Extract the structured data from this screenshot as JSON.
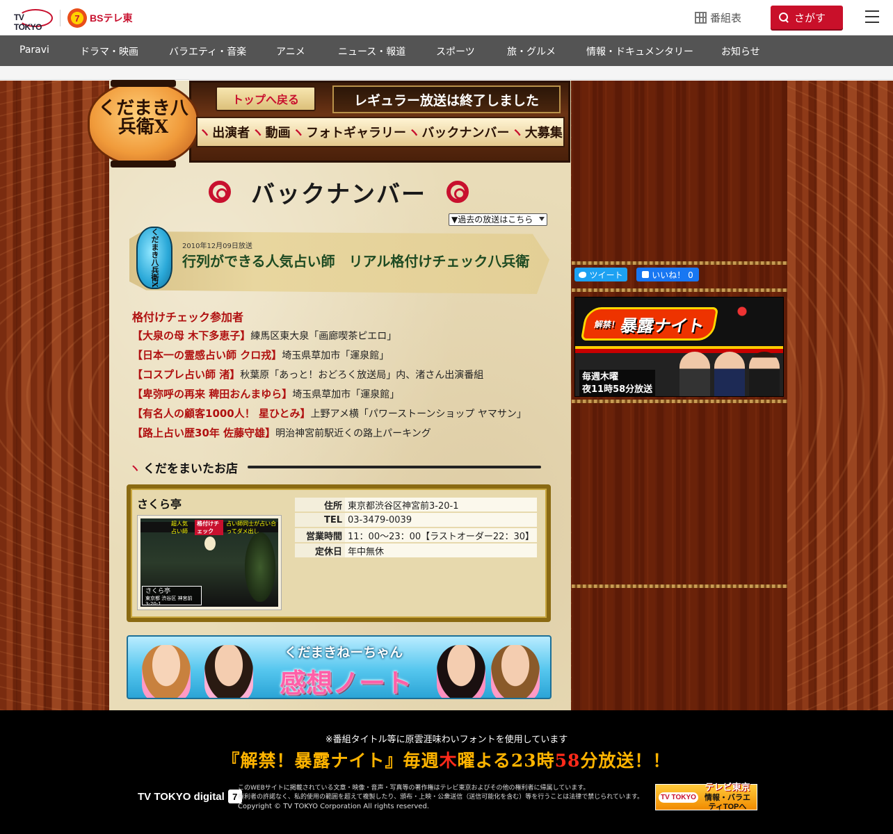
{
  "header": {
    "logo_tvtokyo": "TV TOKYO",
    "logo_bs": "BSテレ東",
    "logo_bs_badge": "7",
    "program_guide": "番組表",
    "search_label": "さがす"
  },
  "nav": {
    "items": [
      "Paravi",
      "ドラマ・映画",
      "バラエティ・音楽",
      "アニメ",
      "ニュース・報道",
      "スポーツ",
      "旅・グルメ",
      "情報・ドキュメンタリー",
      "お知らせ"
    ]
  },
  "banner": {
    "show_title": "くだまき八兵衛X",
    "back_to_top": "トップへ戻る",
    "ended_notice": "レギュラー放送は終了しました",
    "nav_items": [
      "出演者",
      "動画",
      "フォトギャラリー",
      "バックナンバー",
      "大募集"
    ]
  },
  "page": {
    "heading": "バックナンバー",
    "archive_select": "▼過去の放送はこちら"
  },
  "episode": {
    "lantern_text": "くだまき八兵衛X",
    "date": "2010年12月09日放送",
    "title": "行列ができる人気占い師　リアル格付けチェック八兵衛"
  },
  "participants": {
    "heading": "格付けチェック参加者",
    "rows": [
      {
        "name": "【大泉の母 木下多恵子】",
        "place": "練馬区東大泉「画廊喫茶ピエロ」"
      },
      {
        "name": "【日本一の霊感占い師 クロ戎】",
        "place": "埼玉県草加市「運泉館」"
      },
      {
        "name": "【コスプレ占い師 渚】",
        "place": "秋葉原「あっと！おどろく放送局」内、渚さん出演番組"
      },
      {
        "name": "【卑弥呼の再来 稗田おんまゆら】",
        "place": "埼玉県草加市「運泉館」"
      },
      {
        "name": "【有名人の顧客1000人！ 星ひとみ】",
        "place": "上野アメ横「パワーストーンショップ ヤマサン」"
      },
      {
        "name": "【路上占い歴30年 佐藤守雄】",
        "place": "明治神宮前駅近くの路上パーキング"
      }
    ]
  },
  "shop_section": {
    "heading": "くだをまいたお店",
    "name": "さくら亭",
    "photo_strip_a": "超人気占い師",
    "photo_strip_b": "格付けチェック",
    "photo_strip_c": "占い師同士が占い合ってダメ出し",
    "photo_caption_name": "さくら亭",
    "photo_caption_addr": "東京都 渋谷区 神宮前 3-20-1",
    "info": [
      {
        "key": "住所",
        "value": "東京都渋谷区神宮前3-20-1"
      },
      {
        "key": "TEL",
        "value": "03-3479-0039"
      },
      {
        "key": "営業時間",
        "value": "11：00～23：00【ラストオーダー22：30】"
      },
      {
        "key": "定休日",
        "value": "年中無休"
      }
    ]
  },
  "kansou_banner": {
    "line1": "くだまきねーちゃん",
    "line2": "感想ノート"
  },
  "sidebar": {
    "tweet": "ツイート",
    "like": "いいね！ 0",
    "promo_title": "暴露ナイト",
    "promo_prefix": "解禁！",
    "promo_line1": "毎週木曜",
    "promo_line2": "夜11時58分放送"
  },
  "footer": {
    "font_note": "※番組タイトル等に原雲涯味わいフォントを使用しています",
    "promo_a": "『解禁！暴露ナイト』毎週",
    "promo_b": "木",
    "promo_c": "曜よる23時",
    "promo_d": "58",
    "promo_e": "分放送！！",
    "tv_digital": "TV TOKYO digital",
    "tv_digital_num": "7",
    "copyright_1": "このWEBサイトに掲載されている文章・映像・音声・写真等の著作権はテレビ東京およびその他の権利者に帰属しています。",
    "copyright_2": "権利者の許諾なく、私的使用の範囲を超えて複製したり、頒布・上映・公衆送信（送信可能化を含む）等を行うことは法律で禁じられています。",
    "copyright_3": "Copyright © TV TOKYO Corporation All rights reserved.",
    "topa_brand": "TV TOKYO",
    "topa_line1": "テレビ東京",
    "topa_line2": "情報・バラエティTOPへ"
  },
  "colors": {
    "brand_red": "#c9102a",
    "nav_bg": "#545454",
    "episode_title": "#1d4a22",
    "participant_name": "#b01010"
  }
}
